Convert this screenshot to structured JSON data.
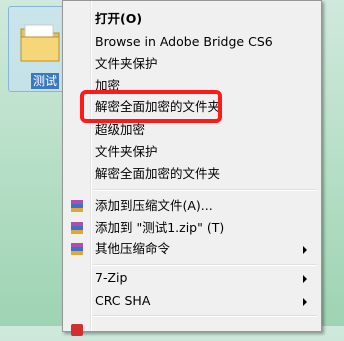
{
  "desktop": {
    "file_label": "测试",
    "folder_icon": "folder-icon"
  },
  "menu": {
    "items": [
      {
        "label": "打开(O)",
        "bold": true
      },
      {
        "label": "Browse in Adobe Bridge CS6"
      },
      {
        "label": "文件夹保护"
      },
      {
        "label": "加密"
      },
      {
        "label": "解密全面加密的文件夹"
      },
      {
        "label": "超级加密"
      },
      {
        "label": "文件夹保护"
      },
      {
        "label": "解密全面加密的文件夹"
      },
      {
        "label": "添加到压缩文件(A)...",
        "icon": "winrar-archive-icon"
      },
      {
        "label": "添加到 \"测试1.zip\" (T)",
        "icon": "winrar-archive-icon"
      },
      {
        "label": "其他压缩命令",
        "icon": "winrar-archive-icon",
        "submenu": true
      },
      {
        "label": "7-Zip",
        "submenu": true
      },
      {
        "label": "CRC SHA",
        "submenu": true
      }
    ]
  },
  "annotation": {
    "highlight_color": "#ff1a1a"
  }
}
